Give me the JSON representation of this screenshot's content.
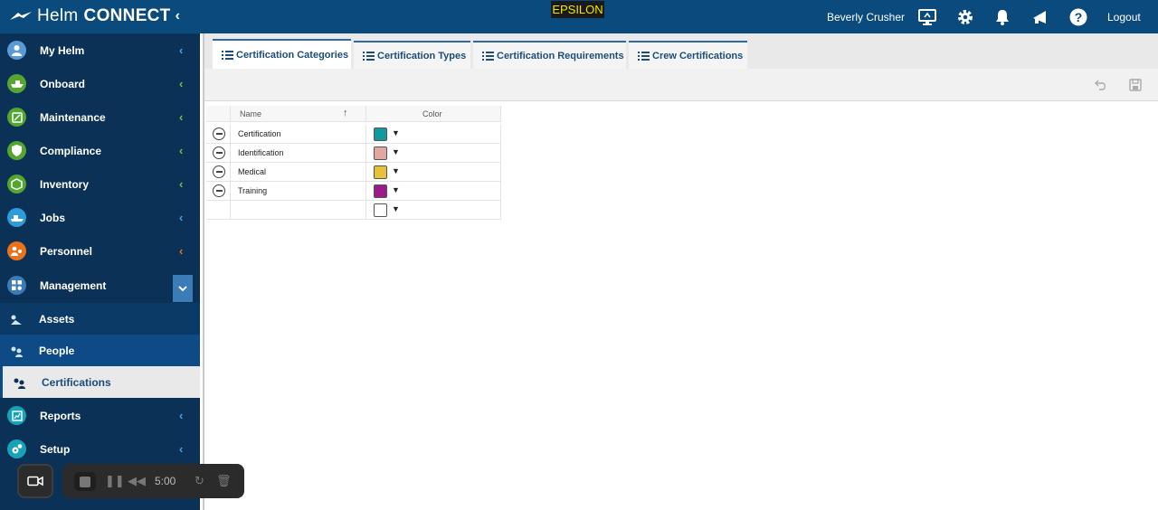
{
  "app": {
    "brand_light": "Helm",
    "brand_bold": "CONNECT",
    "collapse_glyph": "‹",
    "environment": "EPSILON",
    "user_name": "Beverly Crusher",
    "logout_label": "Logout",
    "header_icons": [
      "monitor-help-icon",
      "gear-icon",
      "bell-icon",
      "megaphone-icon",
      "question-icon"
    ]
  },
  "sidebar": {
    "items": [
      {
        "label": "My Helm",
        "icon": "user-icon",
        "icon_color": "#5b9bd5",
        "chevron_color": "#4aa3df"
      },
      {
        "label": "Onboard",
        "icon": "ship-icon",
        "icon_color": "#55a630",
        "chevron_color": "#79c142"
      },
      {
        "label": "Maintenance",
        "icon": "wrench-icon",
        "icon_color": "#55a630",
        "chevron_color": "#79c142"
      },
      {
        "label": "Compliance",
        "icon": "shield-icon",
        "icon_color": "#55a630",
        "chevron_color": "#79c142"
      },
      {
        "label": "Inventory",
        "icon": "box-icon",
        "icon_color": "#55a630",
        "chevron_color": "#79c142"
      },
      {
        "label": "Jobs",
        "icon": "tug-icon",
        "icon_color": "#2d9cdb",
        "chevron_color": "#4aa3df"
      },
      {
        "label": "Personnel",
        "icon": "people-icon",
        "icon_color": "#e8731c",
        "chevron_color": "#e8731c"
      },
      {
        "label": "Management",
        "icon": "grid-icon",
        "icon_color": "#3a7bb8",
        "chevron_color": "#ffffff"
      }
    ],
    "sub_items": [
      {
        "label": "Assets"
      },
      {
        "label": "People"
      },
      {
        "label": "Certifications"
      }
    ],
    "bottom_items": [
      {
        "label": "Reports",
        "icon": "chart-icon",
        "icon_color": "#17a2b8",
        "chevron_color": "#4aa3df"
      },
      {
        "label": "Setup",
        "icon": "gears-icon",
        "icon_color": "#17a2b8",
        "chevron_color": "#4aa3df"
      }
    ]
  },
  "tabs": [
    {
      "label": "Certification Categories",
      "active": true
    },
    {
      "label": "Certification Types",
      "active": false
    },
    {
      "label": "Certification Requirements",
      "active": false
    },
    {
      "label": "Crew Certifications",
      "active": false
    }
  ],
  "grid": {
    "columns": [
      "Name",
      "Color"
    ],
    "sort_glyph": "↑",
    "rows": [
      {
        "name": "Certification",
        "color": "#0f9aa0"
      },
      {
        "name": "Identification",
        "color": "#e0a8a0"
      },
      {
        "name": "Medical",
        "color": "#e6c23a"
      },
      {
        "name": "Training",
        "color": "#9b1b8a"
      },
      {
        "name": "",
        "color": "#ffffff"
      }
    ]
  },
  "recorder": {
    "time": "5:00"
  }
}
